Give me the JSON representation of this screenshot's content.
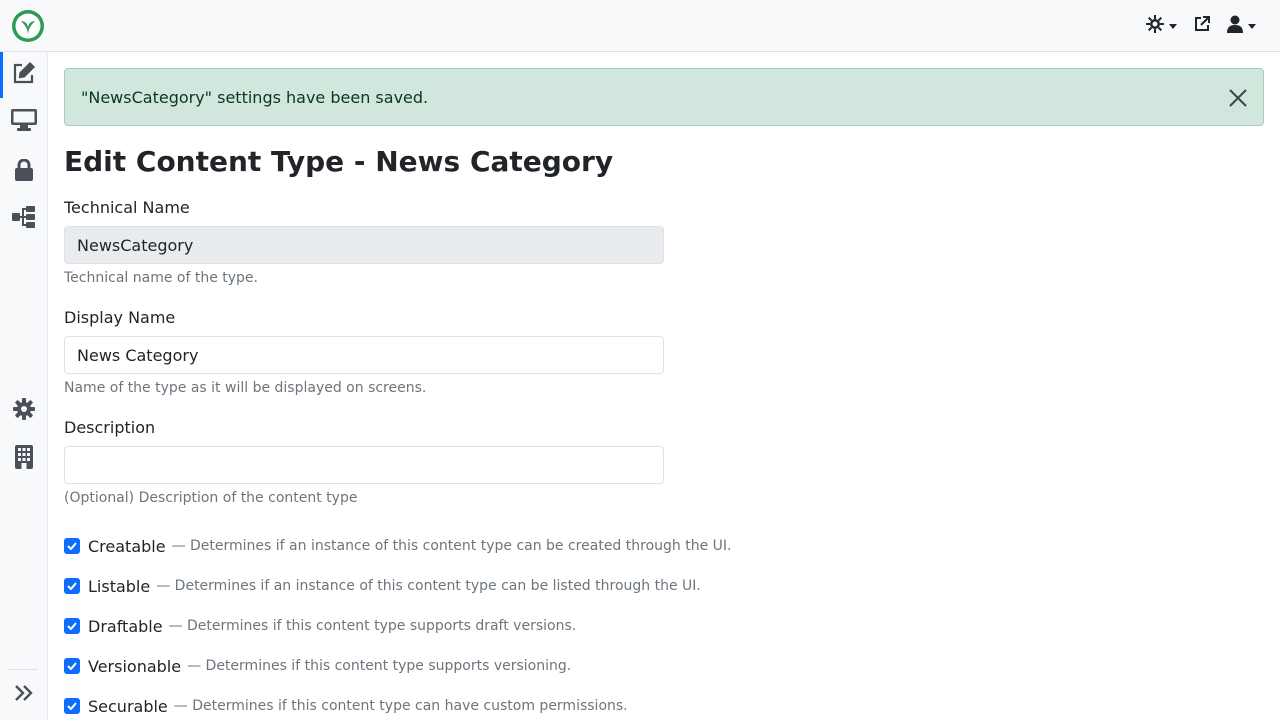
{
  "alert": {
    "message": "\"NewsCategory\" settings have been saved."
  },
  "page": {
    "title": "Edit Content Type - News Category"
  },
  "fields": {
    "technical_name": {
      "label": "Technical Name",
      "value": "NewsCategory",
      "help": "Technical name of the type."
    },
    "display_name": {
      "label": "Display Name",
      "value": "News Category",
      "help": "Name of the type as it will be displayed on screens."
    },
    "description": {
      "label": "Description",
      "value": "",
      "help": "(Optional) Description of the content type"
    }
  },
  "checkboxes": [
    {
      "label": "Creatable",
      "hint": "— Determines if an instance of this content type can be created through the UI.",
      "checked": true
    },
    {
      "label": "Listable",
      "hint": "— Determines if an instance of this content type can be listed through the UI.",
      "checked": true
    },
    {
      "label": "Draftable",
      "hint": "— Determines if this content type supports draft versions.",
      "checked": true
    },
    {
      "label": "Versionable",
      "hint": "— Determines if this content type supports versioning.",
      "checked": true
    },
    {
      "label": "Securable",
      "hint": "— Determines if this content type can have custom permissions.",
      "checked": true
    }
  ],
  "icons": {
    "logo": "orchard-leaf-logo",
    "theme": "theme-toggle-icon",
    "visit_site": "external-link-icon",
    "user": "user-icon",
    "sidebar": [
      "content-edit-icon",
      "design-icon",
      "security-icon",
      "tree-icon",
      "settings-icon",
      "tenants-icon",
      "expand-sidebar-icon"
    ]
  },
  "colors": {
    "accent": "#0d6efd",
    "success_bg": "#d1e7dd",
    "success_text": "#0a3622",
    "logo_green": "#2e9a56"
  }
}
